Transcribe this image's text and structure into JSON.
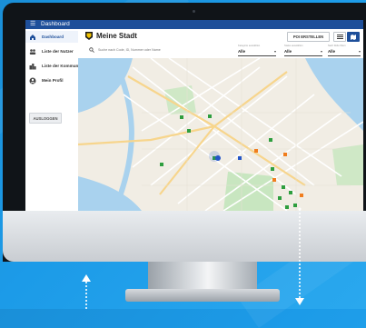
{
  "app": {
    "window_title": "Dashboard",
    "name": "Meine Stadt"
  },
  "sidebar": {
    "items": [
      {
        "label": "Dashboard",
        "icon": "home-icon",
        "active": true
      },
      {
        "label": "Liste der Nutzer",
        "icon": "users-icon",
        "active": false
      },
      {
        "label": "Liste der Kommunen",
        "icon": "buildings-icon",
        "active": false
      },
      {
        "label": "Mein Profil",
        "icon": "profile-icon",
        "active": false
      }
    ],
    "logout_label": "AUSLOGGEN"
  },
  "header": {
    "create_poi_label": "POI ERSTELLEN",
    "view_icons": [
      "list-view-icon",
      "map-view-icon"
    ]
  },
  "filters": {
    "search_placeholder": "Suche nach Code, ID, Nummer oder Name",
    "selects": [
      {
        "label": "Kategorie auswählen",
        "value": "Alle"
      },
      {
        "label": "Status auswählen",
        "value": "Alle"
      },
      {
        "label": "Nach Rolle filtern",
        "value": "Alle"
      }
    ]
  },
  "map": {
    "marker_colors": {
      "green": "#2e9e3e",
      "orange": "#f07d1d",
      "blue": "#2456c8"
    }
  },
  "colors": {
    "accent": "#1e4f9a",
    "background": "#1c9be8"
  }
}
